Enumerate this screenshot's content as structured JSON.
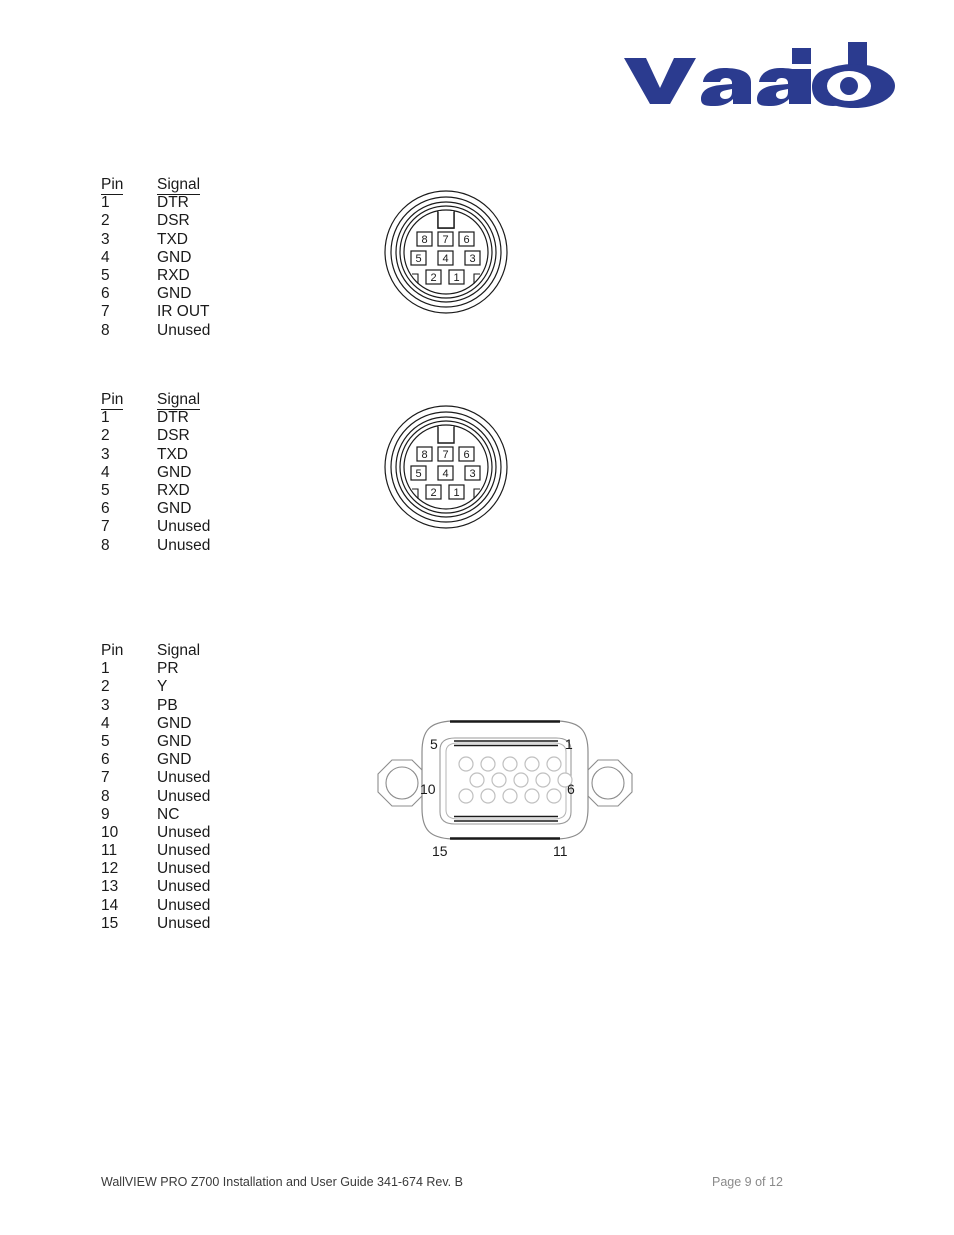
{
  "document": {
    "brand_logo_text": "vaddio",
    "brand_color": "#2b3b8f",
    "footer_left": "WallVIEW PRO Z700 Installation and User Guide 341-674 Rev. B",
    "footer_right": "Page 9 of 12"
  },
  "tables": [
    {
      "id": "pinout-table-1",
      "header_underlined": true,
      "headers": {
        "pin": "Pin",
        "signal": "Signal"
      },
      "rows": [
        {
          "pin": "1",
          "signal": "DTR"
        },
        {
          "pin": "2",
          "signal": "DSR"
        },
        {
          "pin": "3",
          "signal": "TXD"
        },
        {
          "pin": "4",
          "signal": "GND"
        },
        {
          "pin": "5",
          "signal": "RXD"
        },
        {
          "pin": "6",
          "signal": "GND"
        },
        {
          "pin": "7",
          "signal": "IR OUT"
        },
        {
          "pin": "8",
          "signal": "Unused"
        }
      ]
    },
    {
      "id": "pinout-table-2",
      "header_underlined": true,
      "headers": {
        "pin": "Pin",
        "signal": "Signal"
      },
      "rows": [
        {
          "pin": "1",
          "signal": "DTR"
        },
        {
          "pin": "2",
          "signal": "DSR"
        },
        {
          "pin": "3",
          "signal": "TXD"
        },
        {
          "pin": "4",
          "signal": "GND"
        },
        {
          "pin": "5",
          "signal": "RXD"
        },
        {
          "pin": "6",
          "signal": "GND"
        },
        {
          "pin": "7",
          "signal": "Unused"
        },
        {
          "pin": "8",
          "signal": "Unused"
        }
      ]
    },
    {
      "id": "pinout-table-3",
      "header_underlined": false,
      "headers": {
        "pin": "Pin",
        "signal": "Signal"
      },
      "rows": [
        {
          "pin": "1",
          "signal": "PR"
        },
        {
          "pin": "2",
          "signal": "Y"
        },
        {
          "pin": "3",
          "signal": "PB"
        },
        {
          "pin": "4",
          "signal": "GND"
        },
        {
          "pin": "5",
          "signal": "GND"
        },
        {
          "pin": "6",
          "signal": "GND"
        },
        {
          "pin": "7",
          "signal": "Unused"
        },
        {
          "pin": "8",
          "signal": "Unused"
        },
        {
          "pin": "9",
          "signal": "NC"
        },
        {
          "pin": "10",
          "signal": "Unused"
        },
        {
          "pin": "11",
          "signal": "Unused"
        },
        {
          "pin": "12",
          "signal": "Unused"
        },
        {
          "pin": "13",
          "signal": "Unused"
        },
        {
          "pin": "14",
          "signal": "Unused"
        },
        {
          "pin": "15",
          "signal": "Unused"
        }
      ]
    }
  ],
  "connectors": [
    {
      "id": "connector-mini-din-8-top",
      "type": "mini-din-8",
      "pin_rows": [
        [
          "8",
          "7",
          "6"
        ],
        [
          "5",
          "4",
          "3"
        ],
        [
          "2",
          "1"
        ]
      ]
    },
    {
      "id": "connector-mini-din-8-bottom",
      "type": "mini-din-8",
      "pin_rows": [
        [
          "8",
          "7",
          "6"
        ],
        [
          "5",
          "4",
          "3"
        ],
        [
          "2",
          "1"
        ]
      ]
    },
    {
      "id": "connector-db15",
      "type": "db-15-hd",
      "corner_labels": {
        "top_left": "5",
        "top_right": "1",
        "mid_left": "10",
        "mid_right": "6",
        "bottom_left": "15",
        "bottom_right": "11"
      },
      "pin_counts": {
        "row1": 5,
        "row2": 5,
        "row3": 5
      }
    }
  ]
}
